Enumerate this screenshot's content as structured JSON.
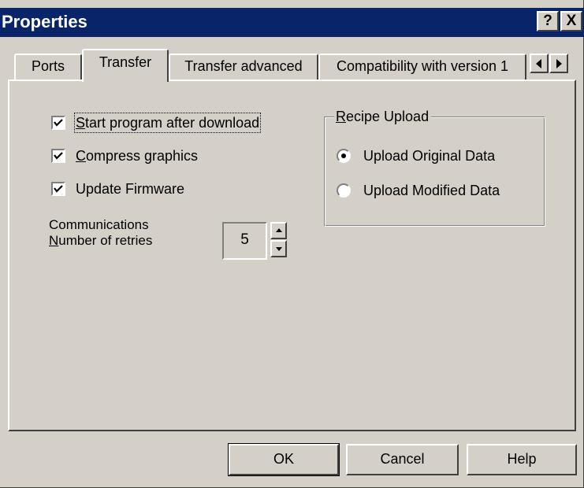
{
  "window": {
    "title": "Properties",
    "help_glyph": "?",
    "close_glyph": "X"
  },
  "tabs": [
    {
      "label": "Ports",
      "selected": false
    },
    {
      "label": "Transfer",
      "selected": true
    },
    {
      "label": "Transfer advanced",
      "selected": false
    },
    {
      "label": "Compatibility with version 1",
      "selected": false
    }
  ],
  "tab_scroll": {
    "left_icon": "arrow-left-icon",
    "right_icon": "arrow-right-icon"
  },
  "options": {
    "start_program": {
      "label": "Start program after download",
      "checked": true
    },
    "compress_graphics": {
      "label": "Compress graphics",
      "checked": true
    },
    "update_firmware": {
      "label": "Update Firmware",
      "checked": true
    }
  },
  "communications": {
    "line1": "Communications",
    "line2": "Number of retries",
    "retries": "5"
  },
  "recipe_upload": {
    "legend": "Recipe Upload",
    "options": [
      {
        "label": "Upload Original Data",
        "selected": true
      },
      {
        "label": "Upload Modified Data",
        "selected": false
      }
    ]
  },
  "buttons": {
    "ok": "OK",
    "cancel": "Cancel",
    "help": "Help"
  },
  "colors": {
    "titlebar": "#0a246a",
    "face": "#d4d0c8"
  }
}
